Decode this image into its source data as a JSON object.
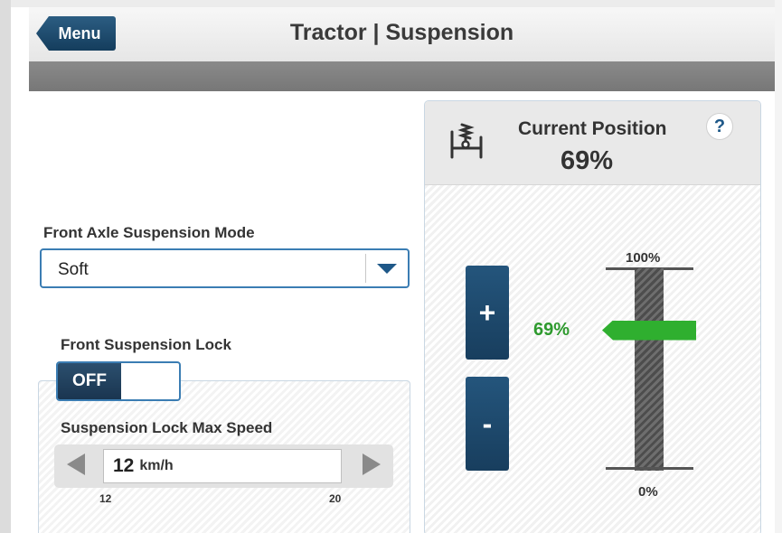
{
  "header": {
    "menu_label": "Menu",
    "title": "Tractor | Suspension"
  },
  "front_axle": {
    "label": "Front Axle Suspension Mode",
    "selected": "Soft"
  },
  "front_lock": {
    "label": "Front Suspension Lock",
    "state": "OFF",
    "max_speed_label": "Suspension Lock Max Speed",
    "speed_value": "12",
    "speed_unit": "km/h",
    "speed_min": "12",
    "speed_max": "20"
  },
  "position": {
    "title": "Current Position",
    "value": "69%",
    "help_label": "?",
    "plus_label": "+",
    "minus_label": "-",
    "scale_max": "100%",
    "scale_min": "0%",
    "marker_label": "69%",
    "marker_fraction": 0.69,
    "marker_color": "#2faf2f"
  },
  "colors": {
    "accent": "#1e5888",
    "button": "#183e5e"
  },
  "icons": {
    "suspension": "suspension-spring-icon",
    "left_arrow": "arrow-left-icon",
    "right_arrow": "arrow-right-icon",
    "dropdown": "chevron-down-icon"
  }
}
